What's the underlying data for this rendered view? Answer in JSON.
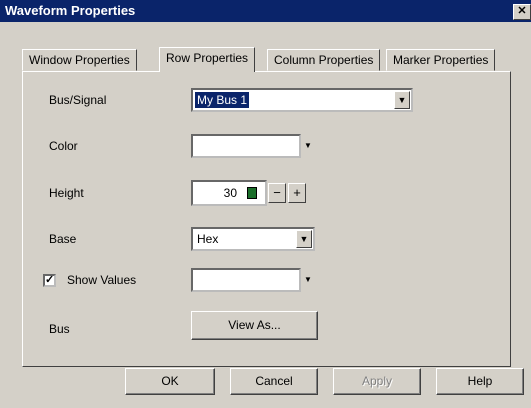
{
  "window": {
    "title": "Waveform Properties",
    "close_glyph": "✕"
  },
  "tabs": [
    {
      "label": "Window Properties"
    },
    {
      "label": "Row Properties"
    },
    {
      "label": "Column Properties"
    },
    {
      "label": "Marker Properties"
    }
  ],
  "active_tab": "Row Properties",
  "fields": {
    "bus_signal": {
      "label": "Bus/Signal",
      "value": "My Bus 1"
    },
    "color": {
      "label": "Color",
      "value": "#ffffff"
    },
    "height": {
      "label": "Height",
      "value": "30",
      "minus": "−",
      "plus": "+"
    },
    "base": {
      "label": "Base",
      "value": "Hex"
    },
    "show_values": {
      "label": "Show Values",
      "checked": true,
      "check_glyph": "✓",
      "color": "#ffffff"
    },
    "bus": {
      "label": "Bus",
      "button": "View As..."
    }
  },
  "buttons": {
    "ok": "OK",
    "cancel": "Cancel",
    "apply": "Apply",
    "help": "Help"
  },
  "icons": {
    "dropdown": "chevron-down-icon",
    "calculator": "calculator-icon"
  }
}
